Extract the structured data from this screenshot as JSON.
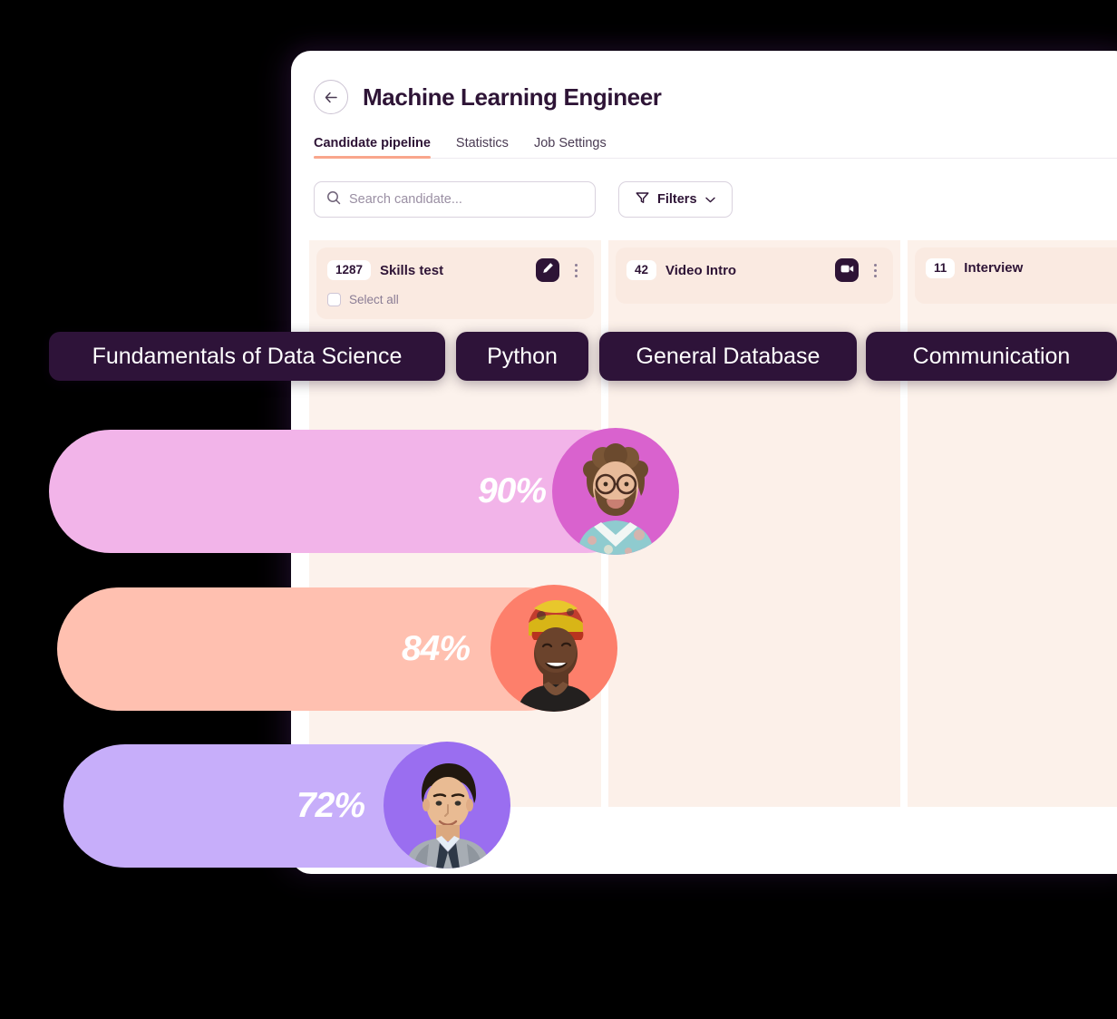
{
  "header": {
    "back_icon": "arrow-left-icon",
    "title": "Machine Learning Engineer"
  },
  "tabs": [
    {
      "label": "Candidate pipeline",
      "active": true
    },
    {
      "label": "Statistics",
      "active": false
    },
    {
      "label": "Job Settings",
      "active": false
    }
  ],
  "toolbar": {
    "search_icon": "search-icon",
    "search_value": "",
    "search_placeholder": "Search candidate...",
    "filters_icon": "funnel-icon",
    "filters_label": "Filters",
    "filters_chevron": "chevron-down-icon"
  },
  "board": {
    "columns": [
      {
        "count": "1287",
        "name": "Skills test",
        "action_icon": "pencil-icon",
        "menu_icon": "kebab-menu-icon",
        "has_action": true,
        "has_select_all": true,
        "select_all_label": "Select all"
      },
      {
        "count": "42",
        "name": "Video Intro",
        "action_icon": "video-camera-icon",
        "menu_icon": "kebab-menu-icon",
        "has_action": true,
        "has_select_all": false,
        "select_all_label": ""
      },
      {
        "count": "11",
        "name": "Interview",
        "action_icon": "",
        "menu_icon": "",
        "has_action": false,
        "has_select_all": false,
        "select_all_label": ""
      }
    ]
  },
  "skill_pills": [
    {
      "label": "Fundamentals of Data Science"
    },
    {
      "label": "Python"
    },
    {
      "label": "General Database"
    },
    {
      "label": "Communication"
    }
  ],
  "score_bars": [
    {
      "percent": "90%",
      "candidate": "bearded-man-glasses",
      "bar_color": "#f2b4e9",
      "accent_color": "#d962ce"
    },
    {
      "percent": "84%",
      "candidate": "smiling-woman-headwrap",
      "bar_color": "#ffc0b0",
      "accent_color": "#fd7f6b"
    },
    {
      "percent": "72%",
      "candidate": "man-grey-blazer",
      "bar_color": "#c7aefa",
      "accent_color": "#9a6ef0"
    }
  ],
  "colors": {
    "background": "#000000",
    "card": "#ffffff",
    "brand_dark": "#2e1436",
    "accent_underline": "#f9a68c",
    "column_bg": "#fcf2ec",
    "column_head_bg": "#faeae1"
  }
}
